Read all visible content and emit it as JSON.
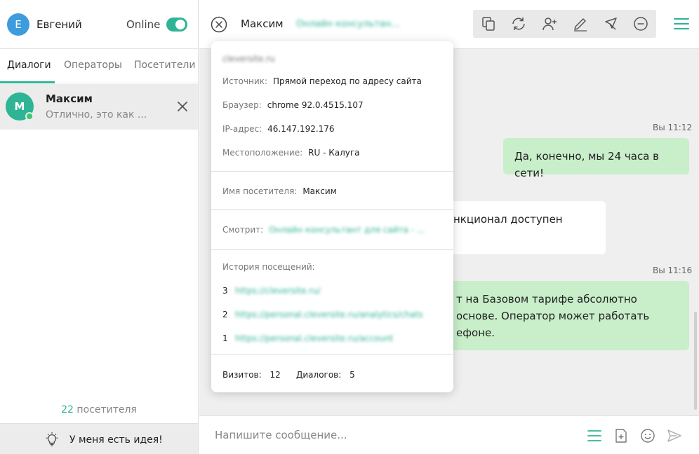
{
  "user": {
    "avatar_letter": "Е",
    "name": "Евгений",
    "status_label": "Online",
    "online": true
  },
  "tabs": [
    {
      "label": "Диалоги",
      "active": true
    },
    {
      "label": "Операторы",
      "active": false
    },
    {
      "label": "Посетители",
      "active": false
    }
  ],
  "dialog": {
    "avatar_letter": "М",
    "name": "Максим",
    "preview": "Отлично, это как ...",
    "online": true
  },
  "visitors": {
    "count": "22",
    "label": "посетителя"
  },
  "idea": {
    "label": "У меня есть идея!"
  },
  "chat": {
    "title": "Максим",
    "subtitle": "Онлайн консультан...",
    "toolbar_icons": [
      "copy-icon",
      "refresh-icon",
      "add-user-icon",
      "pen-icon",
      "cursor-icon",
      "minus-circle-icon"
    ],
    "menu_icon": "hamburger-icon"
  },
  "messages": [
    {
      "time": "Вы 11:12",
      "text": "Да, конечно, мы 24 часа в сети!",
      "from": "operator"
    },
    {
      "text": "нкционал доступен",
      "from": "visitor"
    },
    {
      "time": "Вы 11:16",
      "lines": [
        "т на Базовом тарифе абсолютно",
        "основе. Оператор может работать",
        "ефоне."
      ],
      "from": "operator"
    }
  ],
  "composer": {
    "placeholder": "Напишите сообщение...",
    "icons": [
      "templates-icon",
      "attach-file-icon",
      "emoji-icon",
      "send-icon"
    ]
  },
  "visitor_info": {
    "site": "cleversite.ru",
    "source_label": "Источник:",
    "source": "Прямой переход по адресу сайта",
    "browser_label": "Браузер:",
    "browser": "chrome 92.0.4515.107",
    "ip_label": "IP-адрес:",
    "ip": "46.147.192.176",
    "location_label": "Местоположение:",
    "location": "RU - Калуга",
    "visitor_name_label": "Имя посетителя:",
    "visitor_name": "Максим",
    "watching_label": "Смотрит:",
    "watching": "Онлайн консультант для сайта - ...",
    "history_label": "История посещений:",
    "history": [
      {
        "n": "3",
        "url": "https://cleversite.ru/"
      },
      {
        "n": "2",
        "url": "https://personal.cleversite.ru/analytics/chats"
      },
      {
        "n": "1",
        "url": "https://personal.cleversite.ru/account"
      }
    ],
    "visits_label": "Визитов:",
    "visits": "12",
    "dialogs_label": "Диалогов:",
    "dialogs": "5"
  },
  "colors": {
    "accent": "#2fb495",
    "operator_bubble": "#c8eeca",
    "visitor_bubble": "#ffffff",
    "chat_bg": "#efefef",
    "user_avatar": "#3d9bde"
  }
}
